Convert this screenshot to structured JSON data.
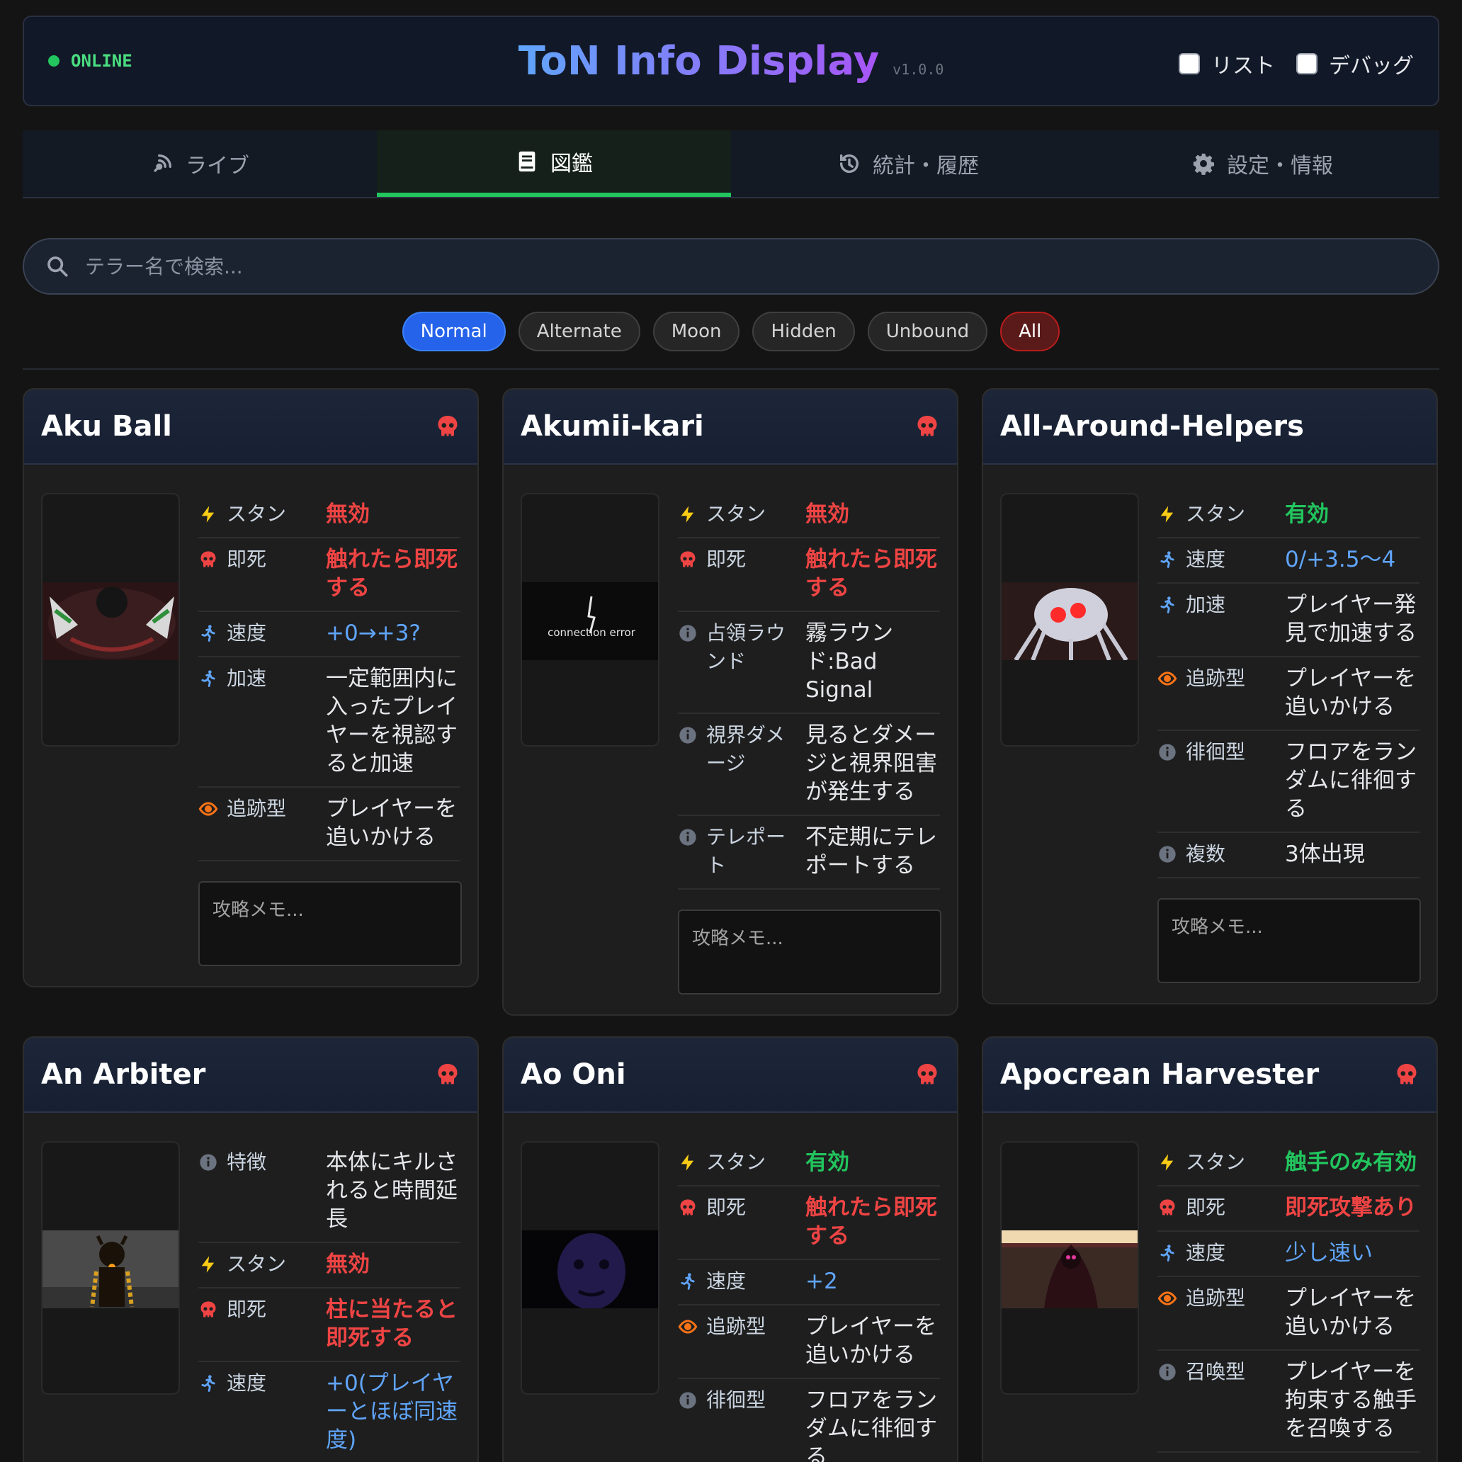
{
  "header": {
    "status": "ONLINE",
    "title": "ToN Info Display",
    "version": "v1.0.0",
    "toggle_list": "リスト",
    "toggle_debug": "デバッグ"
  },
  "tabs": [
    {
      "label": "ライブ",
      "icon": "broadcast-icon"
    },
    {
      "label": "図鑑",
      "icon": "book-icon"
    },
    {
      "label": "統計・履歴",
      "icon": "history-icon"
    },
    {
      "label": "設定・情報",
      "icon": "gear-icon"
    }
  ],
  "search": {
    "placeholder": "テラー名で検索..."
  },
  "filters": [
    "Normal",
    "Alternate",
    "Moon",
    "Hidden",
    "Unbound",
    "All"
  ],
  "memo_placeholder": "攻略メモ...",
  "cards": [
    {
      "name": "Aku Ball",
      "rows": [
        {
          "icon": "lightning-icon",
          "label": "スタン",
          "value": "無効"
        },
        {
          "icon": "skull-icon",
          "label": "即死",
          "value": "触れたら即死する"
        },
        {
          "icon": "runner-icon",
          "label": "速度",
          "value": "+0→+3?"
        },
        {
          "icon": "runner-icon",
          "label": "加速",
          "value": "一定範囲内に入ったプレイヤーを視認すると加速"
        },
        {
          "icon": "eye-icon",
          "label": "追跡型",
          "value": "プレイヤーを追いかける"
        }
      ]
    },
    {
      "name": "Akumii-kari",
      "thumb_caption": "connection error",
      "rows": [
        {
          "icon": "lightning-icon",
          "label": "スタン",
          "value": "無効"
        },
        {
          "icon": "skull-icon",
          "label": "即死",
          "value": "触れたら即死する"
        },
        {
          "icon": "info-icon",
          "label": "占領ラウンド",
          "value": "霧ラウンド:Bad Signal"
        },
        {
          "icon": "info-icon",
          "label": "視界ダメージ",
          "value": "見るとダメージと視界阻害が発生する"
        },
        {
          "icon": "info-icon",
          "label": "テレポート",
          "value": "不定期にテレポートする"
        }
      ]
    },
    {
      "name": "All-Around-Helpers",
      "rows": [
        {
          "icon": "lightning-icon",
          "label": "スタン",
          "value": "有効"
        },
        {
          "icon": "runner-icon",
          "label": "速度",
          "value": "0/+3.5〜4"
        },
        {
          "icon": "runner-icon",
          "label": "加速",
          "value": "プレイヤー発見で加速する"
        },
        {
          "icon": "eye-icon",
          "label": "追跡型",
          "value": "プレイヤーを追いかける"
        },
        {
          "icon": "info-icon",
          "label": "徘徊型",
          "value": "フロアをランダムに徘徊する"
        },
        {
          "icon": "info-icon",
          "label": "複数",
          "value": "3体出現"
        }
      ]
    },
    {
      "name": "An Arbiter",
      "rows": [
        {
          "icon": "info-icon",
          "label": "特徴",
          "value": "本体にキルされると時間延長"
        },
        {
          "icon": "lightning-icon",
          "label": "スタン",
          "value": "無効"
        },
        {
          "icon": "skull-icon",
          "label": "即死",
          "value": "柱に当たると即死する"
        },
        {
          "icon": "runner-icon",
          "label": "速度",
          "value": "+0(プレイヤーとほぼ同速度)"
        }
      ]
    },
    {
      "name": "Ao Oni",
      "rows": [
        {
          "icon": "lightning-icon",
          "label": "スタン",
          "value": "有効"
        },
        {
          "icon": "skull-icon",
          "label": "即死",
          "value": "触れたら即死する"
        },
        {
          "icon": "runner-icon",
          "label": "速度",
          "value": "+2"
        },
        {
          "icon": "eye-icon",
          "label": "追跡型",
          "value": "プレイヤーを追いかける"
        },
        {
          "icon": "info-icon",
          "label": "徘徊型",
          "value": "フロアをランダムに徘徊する"
        }
      ]
    },
    {
      "name": "Apocrean Harvester",
      "rows": [
        {
          "icon": "lightning-icon",
          "label": "スタン",
          "value": "触手のみ有効"
        },
        {
          "icon": "skull-icon",
          "label": "即死",
          "value": "即死攻撃あり"
        },
        {
          "icon": "runner-icon",
          "label": "速度",
          "value": "少し速い"
        },
        {
          "icon": "eye-icon",
          "label": "追跡型",
          "value": "プレイヤーを追いかける"
        },
        {
          "icon": "info-icon",
          "label": "召喚型",
          "value": "プレイヤーを拘束する触手を召喚する"
        }
      ]
    }
  ],
  "colors": {
    "accent_green": "#22c55e",
    "danger_red": "#ef4444",
    "info_blue": "#60a5fa",
    "warn_orange": "#f97316",
    "bolt_yellow": "#facc15"
  }
}
